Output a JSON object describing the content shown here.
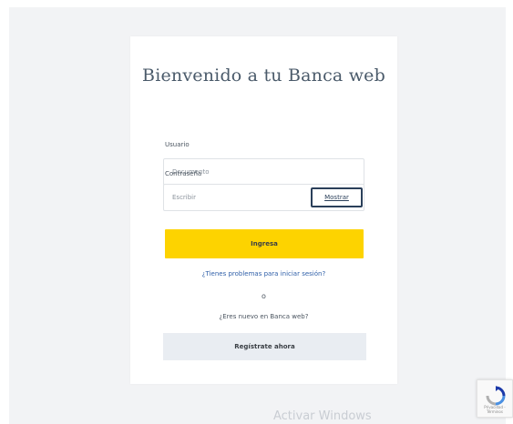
{
  "login": {
    "title": "Bienvenido a tu Banca web",
    "user_label": "Usuario",
    "user_placeholder": "Documento",
    "password_label": "Contraseña",
    "password_value": "Escribir",
    "show_password_label": "Mostrar",
    "submit_label": "Ingresa",
    "forgot_link": "¿Tienes problemas para iniciar sesión?",
    "separator": "o",
    "no_account_text": "¿Eres nuevo en Banca web?",
    "register_label": "Regístrate ahora"
  },
  "watermark": "Activar Windows",
  "recaptcha": {
    "icon": "recaptcha-icon",
    "caption": "Privacidad - Términos"
  },
  "colors": {
    "accent_yellow": "#fdd300",
    "link_blue": "#2f5fa8",
    "secondary_bg": "#e9edf2",
    "dark_navy": "#2a3f5a"
  }
}
